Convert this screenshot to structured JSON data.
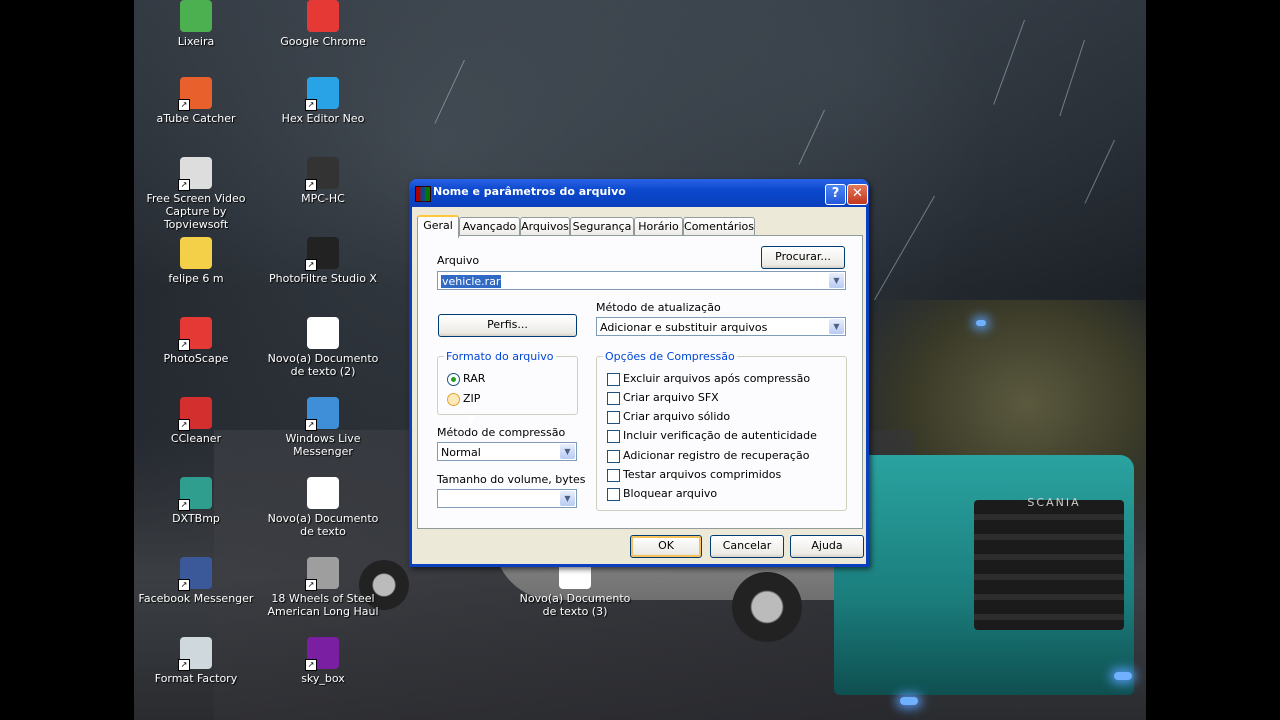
{
  "desktop": {
    "icons": [
      {
        "label": "Lixeira",
        "icon": "recycle-bin-icon",
        "color": "#4caf50"
      },
      {
        "label": "Google Chrome",
        "icon": "chrome-icon",
        "color": "#e53935"
      },
      {
        "label": "aTube Catcher",
        "icon": "atube-catcher-icon",
        "color": "#e8602c"
      },
      {
        "label": "Hex Editor Neo",
        "icon": "hex-editor-icon",
        "color": "#29a3e6"
      },
      {
        "label": "Free Screen Video Capture by Topviewsoft",
        "icon": "screen-capture-icon",
        "color": "#dddddd"
      },
      {
        "label": "MPC-HC",
        "icon": "mpc-hc-icon",
        "color": "#333333"
      },
      {
        "label": "felipe 6 m",
        "icon": "folder-icon",
        "color": "#f4cf48"
      },
      {
        "label": "PhotoFiltre Studio X",
        "icon": "photofiltre-icon",
        "color": "#222222"
      },
      {
        "label": "PhotoScape",
        "icon": "photoscape-icon",
        "color": "#e53935"
      },
      {
        "label": "Novo(a) Documento de texto (2)",
        "icon": "text-document-icon",
        "color": "#ffffff"
      },
      {
        "label": "CCleaner",
        "icon": "ccleaner-icon",
        "color": "#d32f2f"
      },
      {
        "label": "Windows Live Messenger",
        "icon": "messenger-icon",
        "color": "#3f8fd8"
      },
      {
        "label": "DXTBmp",
        "icon": "dxtbmp-icon",
        "color": "#2f9e8e"
      },
      {
        "label": "Novo(a) Documento de texto",
        "icon": "text-document-icon",
        "color": "#ffffff"
      },
      {
        "label": "Facebook Messenger",
        "icon": "facebook-messenger-icon",
        "color": "#3b5998"
      },
      {
        "label": "18 Wheels of Steel American Long Haul",
        "icon": "game-truck-icon",
        "color": "#9e9e9e"
      },
      {
        "label": "Novo(a) Documento de texto (3)",
        "icon": "text-document-icon",
        "color": "#ffffff"
      },
      {
        "label": "Format Factory",
        "icon": "format-factory-icon",
        "color": "#cfd8dc"
      },
      {
        "label": "sky_box",
        "icon": "winrar-archive-icon",
        "color": "#7b1fa2"
      }
    ],
    "truck_badge": "SCANIA"
  },
  "dialog": {
    "title": "Nome e parâmetros do arquivo",
    "help_label": "?",
    "close_label": "✕",
    "tabs": [
      "Geral",
      "Avançado",
      "Arquivos",
      "Segurança",
      "Horário",
      "Comentários"
    ],
    "active_tab": "Geral",
    "archive_label": "Arquivo",
    "archive_value": "vehicle.rar",
    "browse_label": "Procurar...",
    "update_method_label": "Método de atualização",
    "update_method_value": "Adicionar e substituir arquivos",
    "profiles_label": "Perfis...",
    "format_group_label": "Formato do arquivo",
    "format_options": [
      "RAR",
      "ZIP"
    ],
    "format_selected": "RAR",
    "compression_method_label": "Método de compressão",
    "compression_method_value": "Normal",
    "volume_size_label": "Tamanho do volume, bytes",
    "volume_size_value": "",
    "options_group_label": "Opções de Compressão",
    "options": [
      {
        "label": "Excluir arquivos após compressão",
        "checked": false
      },
      {
        "label": "Criar arquivo SFX",
        "checked": false
      },
      {
        "label": "Criar arquivo sólido",
        "checked": false
      },
      {
        "label": "Incluir verificação de autenticidade",
        "checked": false
      },
      {
        "label": "Adicionar registro de recuperação",
        "checked": false
      },
      {
        "label": "Testar arquivos comprimidos",
        "checked": false
      },
      {
        "label": "Bloquear arquivo",
        "checked": false
      }
    ],
    "ok_label": "OK",
    "cancel_label": "Cancelar",
    "help_button_label": "Ajuda",
    "dropdown_arrow": "▼"
  }
}
